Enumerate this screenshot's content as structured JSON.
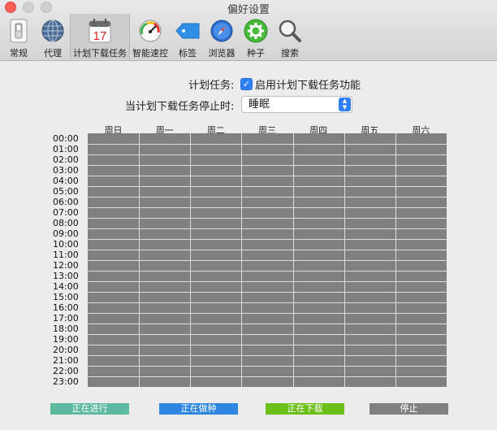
{
  "window": {
    "title": "偏好设置"
  },
  "toolbar": {
    "items": [
      {
        "label": "常规",
        "icon": "switch-icon"
      },
      {
        "label": "代理",
        "icon": "globe-icon"
      },
      {
        "label": "计划下载任务",
        "icon": "calendar-icon",
        "calendar_day": "17",
        "active": true
      },
      {
        "label": "智能速控",
        "icon": "speedometer-icon"
      },
      {
        "label": "标签",
        "icon": "tag-icon"
      },
      {
        "label": "浏览器",
        "icon": "compass-icon"
      },
      {
        "label": "种子",
        "icon": "gear-icon"
      },
      {
        "label": "搜索",
        "icon": "magnifier-icon"
      }
    ]
  },
  "schedule": {
    "label": "计划任务:",
    "enable_checked": true,
    "enable_label": "启用计划下载任务功能",
    "on_stop_label": "当计划下载任务停止时:",
    "on_stop_value": "睡眠"
  },
  "grid": {
    "days": [
      "周日",
      "周一",
      "周二",
      "周三",
      "周四",
      "周五",
      "周六"
    ],
    "hours": [
      "00:00",
      "01:00",
      "02:00",
      "03:00",
      "04:00",
      "05:00",
      "06:00",
      "07:00",
      "08:00",
      "09:00",
      "10:00",
      "11:00",
      "12:00",
      "13:00",
      "14:00",
      "15:00",
      "16:00",
      "17:00",
      "18:00",
      "19:00",
      "20:00",
      "21:00",
      "22:00",
      "23:00"
    ],
    "cell_color": "#808080"
  },
  "legend": [
    {
      "label": "正在进行",
      "color": "#5dbaa1"
    },
    {
      "label": "正在做种",
      "color": "#2f86e0"
    },
    {
      "label": "正在下载",
      "color": "#6cbf18"
    },
    {
      "label": "停止",
      "color": "#808080"
    }
  ]
}
